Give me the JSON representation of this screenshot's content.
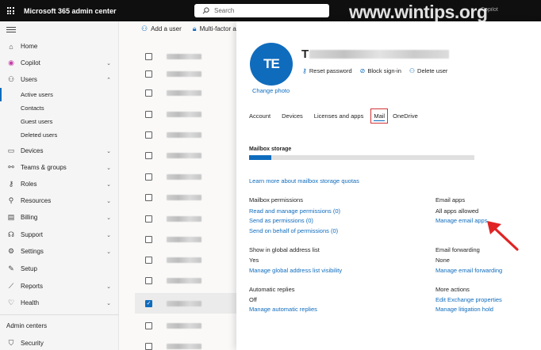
{
  "topbar": {
    "title": "Microsoft 365 admin center",
    "search_placeholder": "Search",
    "copilot": "Copilot",
    "watermark": "www.wintips.org"
  },
  "nav": {
    "home": "Home",
    "copilot": "Copilot",
    "users": "Users",
    "active_users": "Active users",
    "contacts": "Contacts",
    "guest_users": "Guest users",
    "deleted_users": "Deleted users",
    "devices": "Devices",
    "teams_groups": "Teams & groups",
    "roles": "Roles",
    "resources": "Resources",
    "billing": "Billing",
    "support": "Support",
    "settings": "Settings",
    "setup": "Setup",
    "reports": "Reports",
    "health": "Health",
    "admin_centers": "Admin centers",
    "security": "Security"
  },
  "list": {
    "add_user": "Add a user",
    "mfa": "Multi-factor aut"
  },
  "panel": {
    "initials": "TE",
    "user_name": "T",
    "change_photo": "Change photo",
    "reset_password": "Reset password",
    "block_signin": "Block sign-in",
    "delete_user": "Delete user",
    "tabs": {
      "account": "Account",
      "devices": "Devices",
      "licenses": "Licenses and apps",
      "mail": "Mail",
      "onedrive": "OneDrive"
    },
    "mailbox_storage": "Mailbox storage",
    "storage_used_fraction": 0.1,
    "storage_link": "Learn more about mailbox storage quotas",
    "mailbox_permissions": "Mailbox permissions",
    "read_manage": "Read and manage permissions (0)",
    "send_as": "Send as permissions (0)",
    "send_on_behalf": "Send on behalf of permissions (0)",
    "email_apps": "Email apps",
    "all_apps_allowed": "All apps allowed",
    "manage_email_apps": "Manage email apps",
    "gal_title": "Show in global address list",
    "gal_value": "Yes",
    "gal_link": "Manage global address list visibility",
    "fwd_title": "Email forwarding",
    "fwd_value": "None",
    "fwd_link": "Manage email forwarding",
    "auto_title": "Automatic replies",
    "auto_value": "Off",
    "auto_link": "Manage automatic replies",
    "more_title": "More actions",
    "edit_exchange": "Edit Exchange properties",
    "litigation": "Manage litigation hold"
  },
  "colors": {
    "accent": "#0f6cbd",
    "highlight": "#d13438"
  }
}
